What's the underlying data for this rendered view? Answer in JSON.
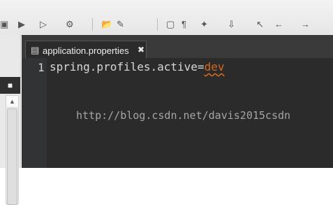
{
  "toolbar": {
    "icons": [
      {
        "name": "debug-icon",
        "glyph": "▣"
      },
      {
        "name": "run-icon",
        "glyph": "▶"
      },
      {
        "name": "run-config-icon",
        "glyph": "▷"
      },
      {
        "name": "new-icon",
        "glyph": "⚙"
      },
      {
        "name": "open-icon",
        "glyph": "📂"
      },
      {
        "name": "brush-icon",
        "glyph": "✎"
      },
      {
        "name": "frame-icon",
        "glyph": "▢"
      },
      {
        "name": "paragraph-icon",
        "glyph": "¶"
      },
      {
        "name": "annotation-icon",
        "glyph": "✦"
      },
      {
        "name": "next-annotation-icon",
        "glyph": "⇩"
      },
      {
        "name": "prev-edit-icon",
        "glyph": "↖"
      },
      {
        "name": "back-icon",
        "glyph": "←"
      },
      {
        "name": "forward-icon",
        "glyph": "→"
      }
    ]
  },
  "left_panel": {
    "tab_icon": "■",
    "scroll_up_icon": "▲"
  },
  "editor": {
    "tab": {
      "label": "application.properties",
      "icon": "▤",
      "close": "✖"
    },
    "line_number": "1",
    "code": {
      "key": "spring.profiles.active",
      "equals": "=",
      "value": "dev"
    }
  },
  "watermark": "http://blog.csdn.net/davis2015csdn"
}
